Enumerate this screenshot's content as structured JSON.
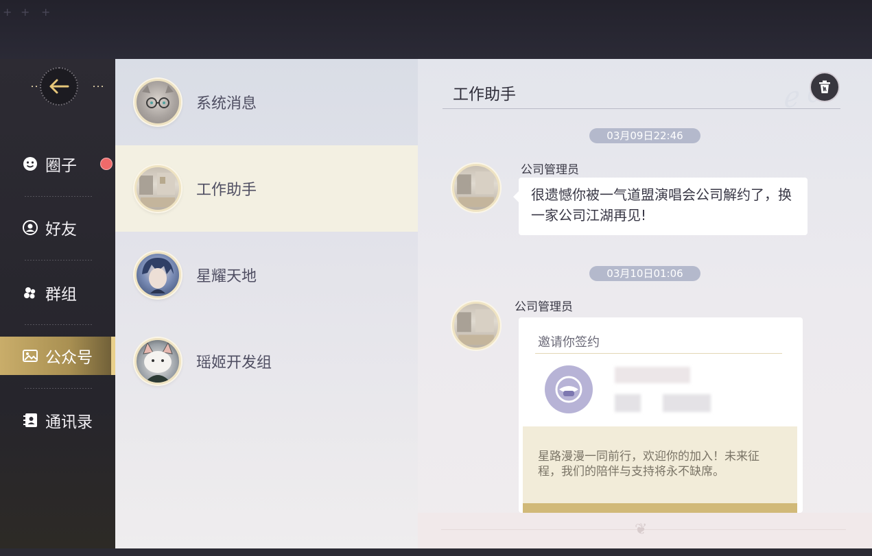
{
  "sidebar": {
    "back_icon": "arrow-left-icon",
    "items": [
      {
        "label": "圈子",
        "icon": "smiley-icon",
        "badge": true
      },
      {
        "label": "好友",
        "icon": "person-circle-icon"
      },
      {
        "label": "群组",
        "icon": "group-icon"
      },
      {
        "label": "公众号",
        "icon": "image-icon",
        "active": true
      },
      {
        "label": "通讯录",
        "icon": "contacts-icon"
      }
    ]
  },
  "contacts": [
    {
      "name": "系统消息",
      "avatar": "cat-glasses"
    },
    {
      "name": "工作助手",
      "avatar": "office",
      "selected": true
    },
    {
      "name": "星耀天地",
      "avatar": "blue-hair-man"
    },
    {
      "name": "瑶姬开发组",
      "avatar": "dog"
    }
  ],
  "chat": {
    "title": "工作助手",
    "messages": [
      {
        "timestamp": "03月09日22:46",
        "sender": "公司管理员",
        "text": "很遗憾你被一气道盟演唱会公司解约了，换一家公司江湖再见!"
      },
      {
        "timestamp": "03月10日01:06",
        "sender": "公司管理员",
        "card_title": "邀请你签约",
        "card_note": "星路漫漫一同前行，欢迎你的加入！未来征程，我们的陪伴与支持将永不缺席。"
      }
    ]
  },
  "colors": {
    "accent_gold": "#c9ad6a",
    "badge_red": "#ef6a6a"
  }
}
